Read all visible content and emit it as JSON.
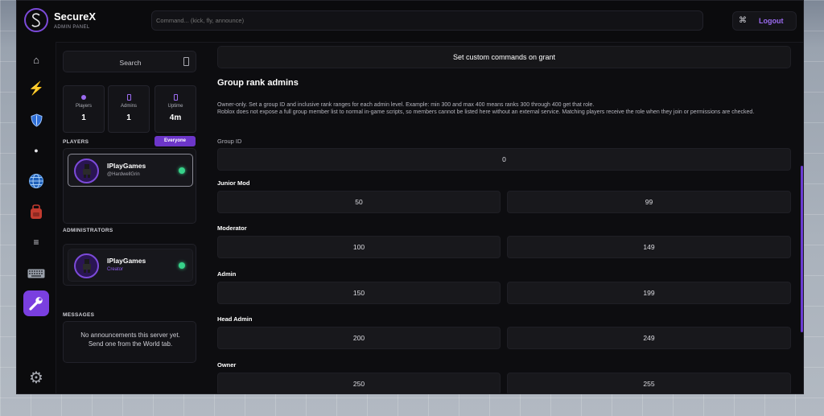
{
  "app": {
    "name": "SecureX",
    "subtitle": "ADMIN PANEL"
  },
  "header": {
    "command_placeholder": "Command... (kick, fly, announce)",
    "command_key_icon": "command-key-icon",
    "logout_label": "Logout"
  },
  "rail": {
    "items": [
      {
        "name": "home-icon",
        "glyph": "⌂"
      },
      {
        "name": "lightning-icon",
        "glyph": "⚡"
      },
      {
        "name": "shield-icon",
        "glyph": ""
      },
      {
        "name": "dot-icon",
        "glyph": "●"
      },
      {
        "name": "globe-icon",
        "glyph": "🌐"
      },
      {
        "name": "backpack-icon",
        "glyph": "🎒"
      },
      {
        "name": "menu-icon",
        "glyph": "≡"
      },
      {
        "name": "keyboard-icon",
        "glyph": "⌨"
      },
      {
        "name": "wrench-icon",
        "glyph": "🔧"
      },
      {
        "name": "gear-icon",
        "glyph": "⚙"
      }
    ]
  },
  "sidebar": {
    "search_label": "Search",
    "stats": [
      {
        "label": "Players",
        "value": "1"
      },
      {
        "label": "Admins",
        "value": "1"
      },
      {
        "label": "Uptime",
        "value": "4m"
      }
    ],
    "players_label": "PLAYERS",
    "everyone_label": "Everyone",
    "players": [
      {
        "name": "IPlayGames",
        "sub": "@HardwellGrin"
      }
    ],
    "administrators_label": "ADMINISTRATORS",
    "administrators": [
      {
        "name": "IPlayGames",
        "sub": "Creator"
      }
    ],
    "messages_label": "MESSAGES",
    "messages_empty_line1": "No announcements this server yet.",
    "messages_empty_line2": "Send one from the World tab."
  },
  "main": {
    "custom_commands_button": "Set custom commands on grant",
    "title": "Group rank admins",
    "desc_line1": "Owner-only. Set a group ID and inclusive rank ranges for each admin level. Example: min 300 and max 400 means ranks 300 through 400 get that role.",
    "desc_line2": "Roblox does not expose a full group member list to normal in-game scripts, so members cannot be listed here without an external service. Matching players receive the role when they join or permissions are checked.",
    "group_id_label": "Group ID",
    "group_id_value": "0",
    "levels": [
      {
        "label": "Junior Mod",
        "min": "50",
        "max": "99"
      },
      {
        "label": "Moderator",
        "min": "100",
        "max": "149"
      },
      {
        "label": "Admin",
        "min": "150",
        "max": "199"
      },
      {
        "label": "Head Admin",
        "min": "200",
        "max": "249"
      },
      {
        "label": "Owner",
        "min": "250",
        "max": "255"
      }
    ]
  },
  "colors": {
    "accent": "#7a3fe0",
    "online": "#37d28a",
    "panel": "#0d0d10"
  }
}
